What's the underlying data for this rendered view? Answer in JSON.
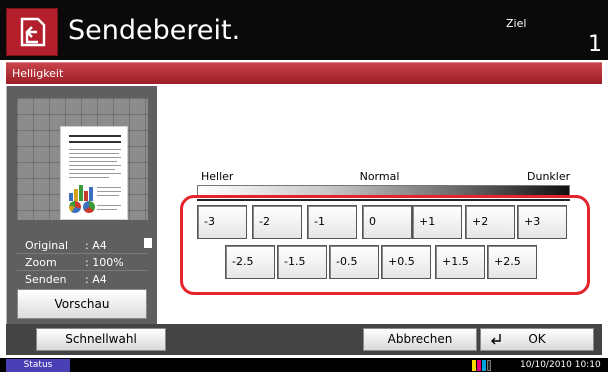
{
  "header": {
    "title": "Sendebereit.",
    "destination_label": "Ziel",
    "destination_count": "1",
    "icon": "send-icon"
  },
  "titlebar": {
    "label": "Helligkeit"
  },
  "preview": {
    "info": [
      {
        "label": "Original",
        "value": ": A4"
      },
      {
        "label": "Zoom",
        "value": ": 100%"
      },
      {
        "label": "Senden",
        "value": ": A4"
      }
    ],
    "preview_button": "Vorschau"
  },
  "scale": {
    "left_label": "Heller",
    "center_label": "Normal",
    "right_label": "Dunkler"
  },
  "levels": {
    "row1": [
      "-3",
      "-2",
      "-1",
      "0",
      "+1",
      "+2",
      "+3"
    ],
    "row2": [
      "-2.5",
      "-1.5",
      "-0.5",
      "+0.5",
      "+1.5",
      "+2.5"
    ]
  },
  "bottom": {
    "quick_button": "Schnellwahl",
    "cancel_button": "Abbrechen",
    "ok_button": "OK"
  },
  "status": {
    "status_button": "Status",
    "datetime": "10/10/2010  10:10"
  },
  "colors": {
    "accent": "#b3202b",
    "highlight": "#e4232c",
    "status_button": "#4a3fb5"
  }
}
